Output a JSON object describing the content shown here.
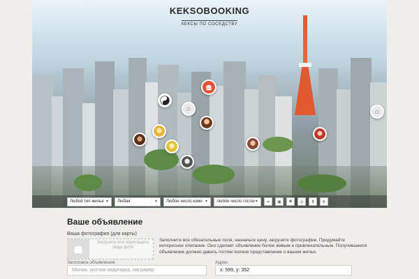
{
  "header": {
    "logo_title": "KEKSOBOOKING",
    "logo_subtitle": "КЕКСЫ ПО СОСЕДСТВУ"
  },
  "map": {
    "pins": [
      {
        "name": "pin-yin-yang",
        "icon": "yin-yang-icon"
      },
      {
        "name": "pin-house",
        "icon": "house-icon"
      },
      {
        "name": "pin-avatar-1",
        "icon": "avatar-icon"
      },
      {
        "name": "pin-avatar-2",
        "icon": "avatar-icon"
      },
      {
        "name": "pin-avatar-3",
        "icon": "avatar-icon"
      },
      {
        "name": "pin-avatar-4",
        "icon": "avatar-icon"
      },
      {
        "name": "pin-avatar-5",
        "icon": "avatar-icon"
      },
      {
        "name": "pin-avatar-6",
        "icon": "avatar-icon"
      },
      {
        "name": "pin-house-2",
        "icon": "house-icon"
      },
      {
        "name": "pin-avatar-7",
        "icon": "avatar-icon"
      }
    ],
    "main_pin_icon": "muffin-icon",
    "main_pin_color": "#e5523c"
  },
  "filters": {
    "type": "Любой тип жилья",
    "price": "Любая",
    "rooms": "Любое число комн",
    "guests": "Любое число гостей",
    "features": [
      {
        "icon": "wifi-icon",
        "glyph": "ᯤ"
      },
      {
        "icon": "dishwasher-icon",
        "glyph": "▣"
      },
      {
        "icon": "parking-icon",
        "glyph": "◙"
      },
      {
        "icon": "washer-icon",
        "glyph": "◎"
      },
      {
        "icon": "elevator-icon",
        "glyph": "⬍"
      },
      {
        "icon": "conditioner-icon",
        "glyph": "❄"
      }
    ]
  },
  "form": {
    "title": "Ваше объявление",
    "photo_label": "Ваша фотография (для карты)",
    "drop_text": "Загрузите или перетащите сюда фото",
    "hint": "Заполните все обязательные поля, назначьте цену, загрузите фотографии. Придумайте интересное описание. Оно сделает объявление более живым и привлекательным. Получившееся объявление должно давать гостям полное представление о вашем жилье.",
    "title_label": "Заголовок объявления",
    "title_placeholder": "Милая, уютная квартирка, нагример",
    "address_label": "Адрес",
    "address_value": "x: 599, y: 352"
  }
}
